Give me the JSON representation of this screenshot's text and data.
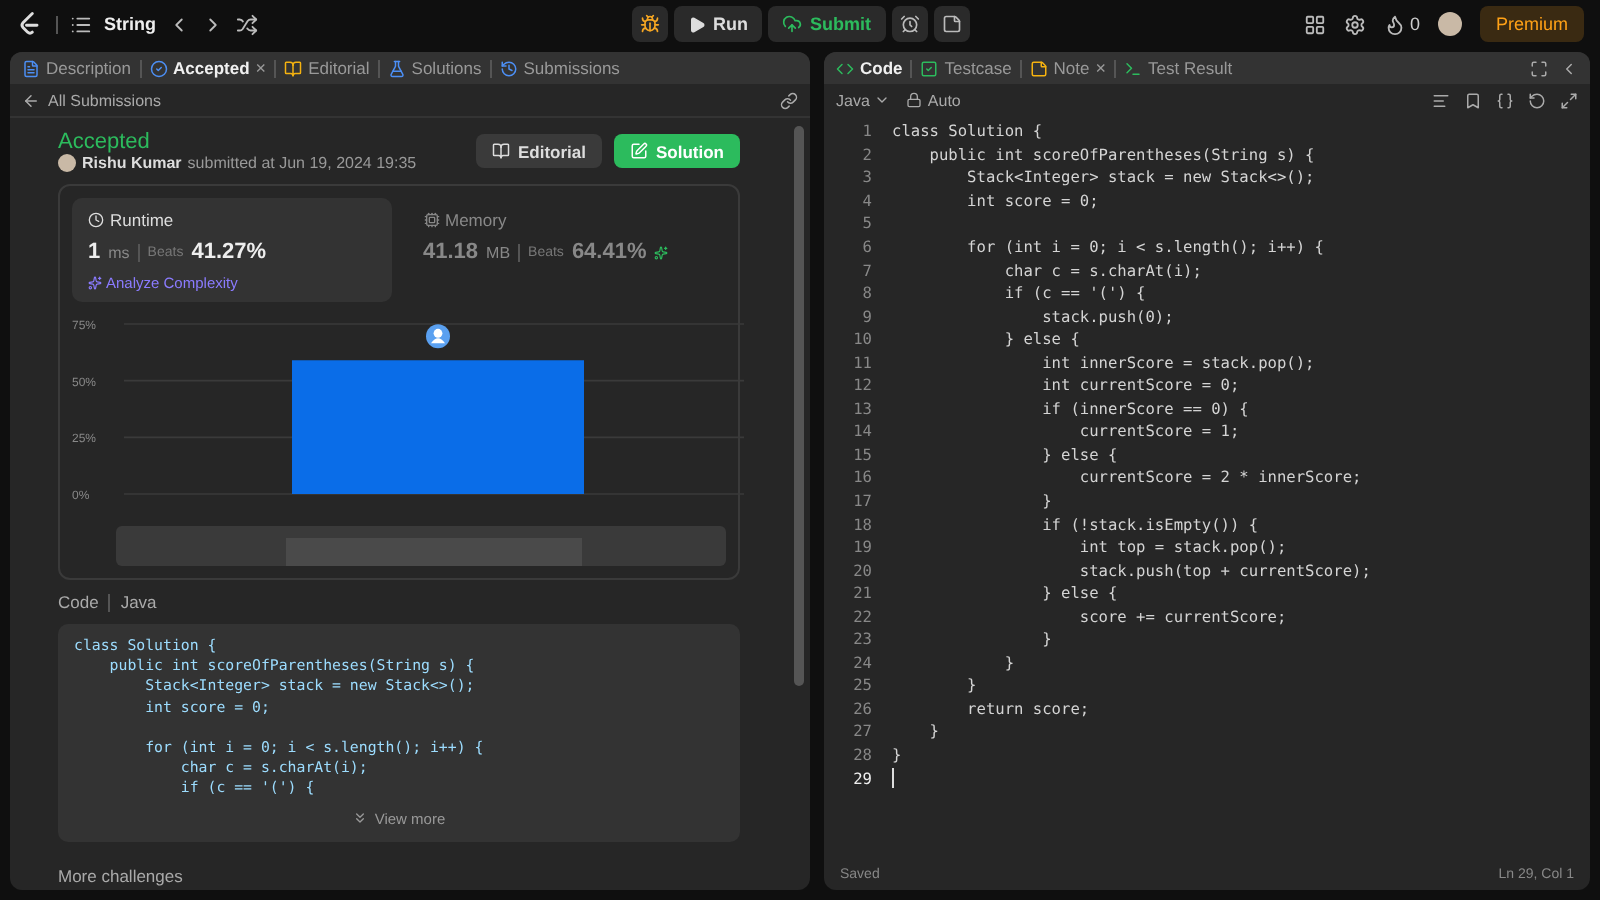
{
  "top_bar": {
    "problem_list": "String",
    "run_button": "Run",
    "submit_button": "Submit",
    "streak_count": "0",
    "premium_button": "Premium"
  },
  "left_panel": {
    "tabs": [
      {
        "label": "Description",
        "selected": false,
        "kind": "description"
      },
      {
        "label": "Accepted",
        "selected": true,
        "kind": "accepted",
        "close": "×"
      },
      {
        "label": "Editorial",
        "selected": false,
        "kind": "editorial"
      },
      {
        "label": "Solutions",
        "selected": false,
        "kind": "solutions"
      },
      {
        "label": "Submissions",
        "selected": false,
        "kind": "submissions"
      }
    ],
    "back_link": "All Submissions",
    "submission": {
      "status": "Accepted",
      "author": "Rishu Kumar",
      "submitted": "submitted at Jun 19, 2024 19:35"
    },
    "buttons": [
      {
        "label": "Editorial",
        "kind": "secondary"
      },
      {
        "label": "Solution",
        "kind": "primary"
      }
    ],
    "stats": [
      {
        "kind": "runtime",
        "label": "Runtime",
        "value": "1",
        "unit": "ms",
        "beats_label": "Beats",
        "beats": "41.27%",
        "selected": true,
        "link": "Analyze Complexity"
      },
      {
        "kind": "memory",
        "label": "Memory",
        "value": "41.18",
        "unit": "MB",
        "beats_label": "Beats",
        "beats": "64.41%",
        "selected": false
      }
    ],
    "chart_data": {
      "type": "bar",
      "values": [
        59
      ],
      "ylim": [
        0,
        75
      ],
      "yticks": [
        {
          "value": 0,
          "label": "0%"
        },
        {
          "value": 25,
          "label": "25%"
        },
        {
          "value": 50,
          "label": "50%"
        },
        {
          "value": 75,
          "label": "75%"
        }
      ]
    },
    "code_section": {
      "label": "Code",
      "language": "Java",
      "view_more": "View more",
      "lines": [
        {
          "text": "class Solution {"
        },
        {
          "text": "    public int scoreOfParentheses(String s) {"
        },
        {
          "text": "        Stack<Integer> stack = new Stack<>();"
        },
        {
          "text": "        int score = 0;"
        },
        {
          "kind": "blank"
        },
        {
          "text": "        for (int i = 0; i < s.length(); i++) {"
        },
        {
          "text": "            char c = s.charAt(i);"
        },
        {
          "text": "            if (c == '(') {"
        }
      ]
    },
    "more_challenges": "More challenges"
  },
  "right_panel": {
    "tabs": [
      {
        "label": "Code",
        "selected": true,
        "kind": "code"
      },
      {
        "label": "Testcase",
        "selected": false,
        "kind": "testcase"
      },
      {
        "label": "Note",
        "selected": false,
        "kind": "note",
        "close": "×"
      },
      {
        "label": "Test Result",
        "selected": false,
        "kind": "result"
      }
    ],
    "language": "Java",
    "mode": "Auto",
    "lines": [
      {
        "n": "1",
        "text": "class Solution {",
        "current": false
      },
      {
        "n": "2",
        "text": "    public int scoreOfParentheses(String s) {",
        "current": false
      },
      {
        "n": "3",
        "text": "        Stack<Integer> stack = new Stack<>();",
        "current": false
      },
      {
        "n": "4",
        "text": "        int score = 0;",
        "current": false
      },
      {
        "n": "5",
        "current": false
      },
      {
        "n": "6",
        "text": "        for (int i = 0; i < s.length(); i++) {",
        "current": false
      },
      {
        "n": "7",
        "text": "            char c = s.charAt(i);",
        "current": false
      },
      {
        "n": "8",
        "text": "            if (c == '(') {",
        "current": false
      },
      {
        "n": "9",
        "text": "                stack.push(0);",
        "current": false
      },
      {
        "n": "10",
        "text": "            } else {",
        "current": false
      },
      {
        "n": "11",
        "text": "                int innerScore = stack.pop();",
        "current": false
      },
      {
        "n": "12",
        "text": "                int currentScore = 0;",
        "current": false
      },
      {
        "n": "13",
        "text": "                if (innerScore == 0) {",
        "current": false
      },
      {
        "n": "14",
        "text": "                    currentScore = 1;",
        "current": false
      },
      {
        "n": "15",
        "text": "                } else {",
        "current": false
      },
      {
        "n": "16",
        "text": "                    currentScore = 2 * innerScore;",
        "current": false
      },
      {
        "n": "17",
        "text": "                }",
        "current": false
      },
      {
        "n": "18",
        "text": "                if (!stack.isEmpty()) {",
        "current": false
      },
      {
        "n": "19",
        "text": "                    int top = stack.pop();",
        "current": false
      },
      {
        "n": "20",
        "text": "                    stack.push(top + currentScore);",
        "current": false
      },
      {
        "n": "21",
        "text": "                } else {",
        "current": false
      },
      {
        "n": "22",
        "text": "                    score += currentScore;",
        "current": false
      },
      {
        "n": "23",
        "text": "                }",
        "current": false
      },
      {
        "n": "24",
        "text": "            }",
        "current": false
      },
      {
        "n": "25",
        "text": "        }",
        "current": false
      },
      {
        "n": "26",
        "text": "        return score;",
        "current": false
      },
      {
        "n": "27",
        "text": "    }",
        "current": false
      },
      {
        "n": "28",
        "text": "}",
        "current": false
      },
      {
        "n": "29",
        "current": true
      }
    ],
    "status": "Saved",
    "position": "Ln 29, Col 1"
  }
}
